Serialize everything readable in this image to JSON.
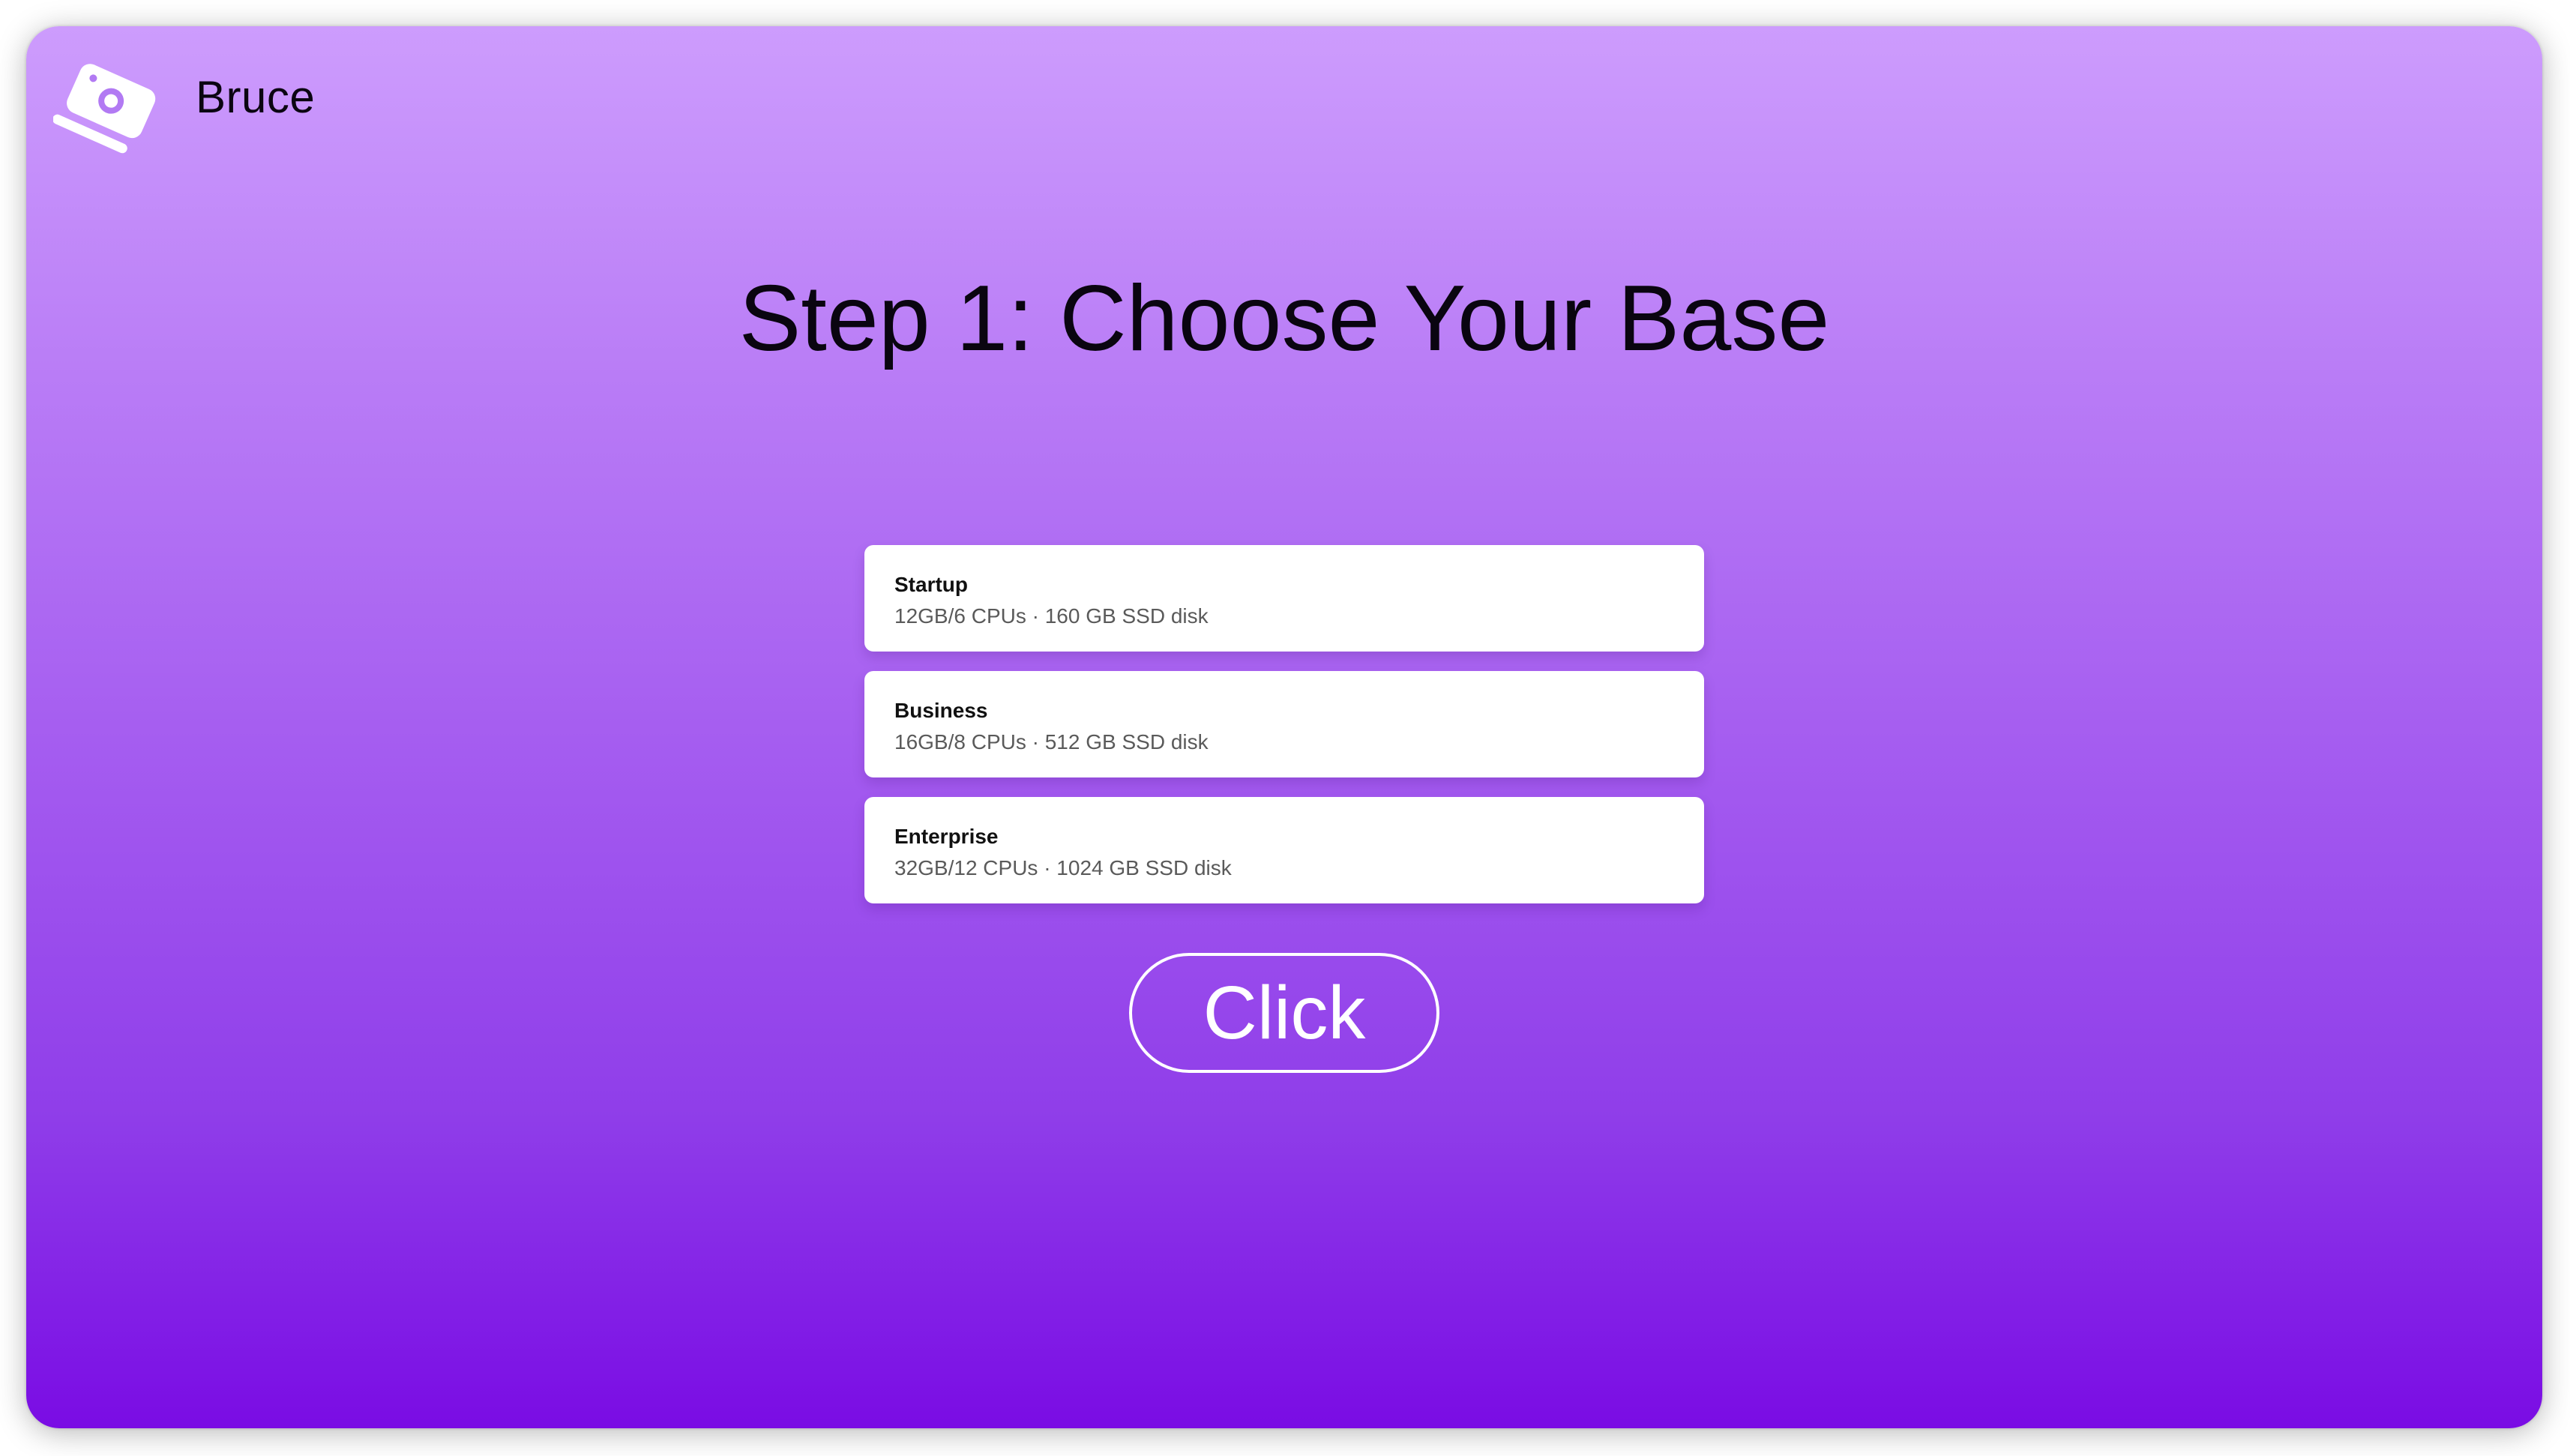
{
  "app": {
    "name": "Bruce",
    "logo_icon": "camera-card-icon"
  },
  "page": {
    "title": "Step 1: Choose Your Base"
  },
  "plans": [
    {
      "name": "Startup",
      "spec": "12GB/6 CPUs · 160 GB SSD disk"
    },
    {
      "name": "Business",
      "spec": "16GB/8 CPUs · 512 GB SSD disk"
    },
    {
      "name": "Enterprise",
      "spec": "32GB/12 CPUs · 1024 GB SSD disk"
    }
  ],
  "cta": {
    "label": "Click"
  },
  "colors": {
    "gradient_top": "#cd9cfd",
    "gradient_bottom": "#7a0ce4",
    "card": "#ffffff",
    "title_text": "#0a0510",
    "cta_text": "#ffffff"
  }
}
